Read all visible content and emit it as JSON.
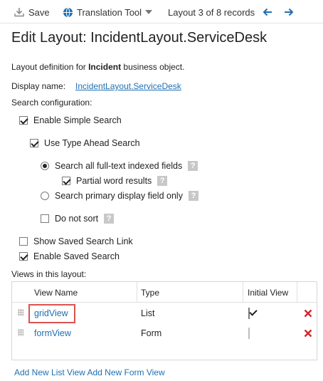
{
  "toolbar": {
    "save_label": "Save",
    "translation_label": "Translation Tool",
    "record_status": "Layout 3 of 8 records",
    "icons": [
      "save-icon",
      "globe-icon",
      "dropdown-caret-icon",
      "arrow-left-icon",
      "arrow-right-icon"
    ]
  },
  "page": {
    "title": "Edit Layout: IncidentLayout.ServiceDesk",
    "description_prefix": "Layout definition for ",
    "description_bold": "Incident",
    "description_suffix": " business object.",
    "display_name_label": "Display name:",
    "display_name_value": "IncidentLayout.ServiceDesk",
    "search_config_label": "Search configuration:"
  },
  "options": {
    "enable_simple_search": {
      "label": "Enable Simple Search",
      "checked": true
    },
    "use_type_ahead": {
      "label": "Use Type Ahead Search",
      "checked": true
    },
    "search_all_fulltext": {
      "label": "Search all full-text indexed fields",
      "selected": true
    },
    "partial_word": {
      "label": "Partial word results",
      "checked": true
    },
    "search_primary": {
      "label": "Search primary display field only",
      "selected": false
    },
    "do_not_sort": {
      "label": "Do not sort",
      "checked": false
    },
    "show_saved_search_link": {
      "label": "Show Saved Search Link",
      "checked": false
    },
    "enable_saved_search": {
      "label": "Enable Saved Search",
      "checked": true
    },
    "help_glyph": "?"
  },
  "views": {
    "label": "Views in this layout:",
    "columns": [
      "View Name",
      "Type",
      "Initial View"
    ],
    "rows": [
      {
        "name": "gridView",
        "type": "List",
        "initial": true,
        "initial_enabled": true
      },
      {
        "name": "formView",
        "type": "Form",
        "initial": false,
        "initial_enabled": false
      }
    ]
  },
  "footer": {
    "add_list_view": "Add New List View",
    "add_form_view": "Add New Form View"
  },
  "colors": {
    "link": "#1f6fb3",
    "delete": "#d9232a",
    "highlight": "#d9534f",
    "nav_arrow": "#1f6fb3"
  }
}
